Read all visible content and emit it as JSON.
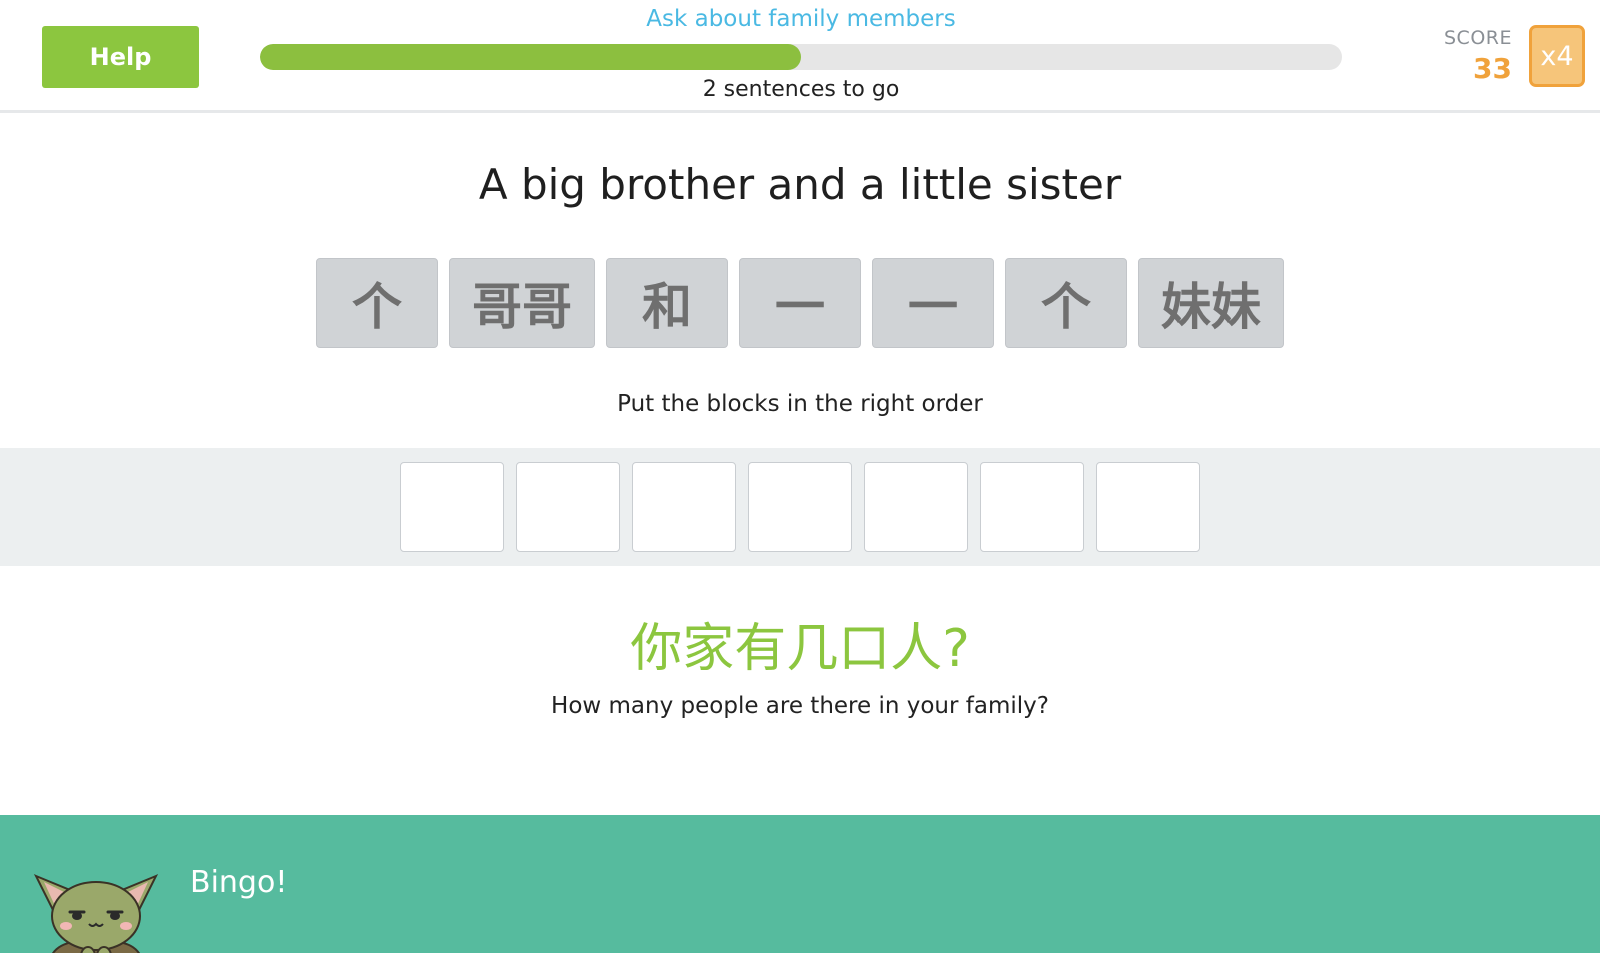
{
  "header": {
    "help_label": "Help",
    "lesson_title": "Ask about family members",
    "progress_fraction": 0.5,
    "progress_caption": "2 sentences to go",
    "score_label": "SCORE",
    "score_value": "33",
    "multiplier": "x4"
  },
  "prompt": {
    "sentence": "A big brother and a little sister",
    "blocks": [
      "个",
      "哥哥",
      "和",
      "一",
      "一",
      "个",
      "妹妹"
    ],
    "instruction": "Put the blocks in the right order",
    "answer_slot_count": 7
  },
  "topic": {
    "chinese": "你家有几口人?",
    "english": "How many people are there in your family?"
  },
  "feedback": {
    "message": "Bingo!",
    "mascot_icon": "cat-mascot-icon"
  },
  "colors": {
    "accent_green": "#8cc63f",
    "title_blue": "#4ab9e3",
    "score_orange": "#f0a23b",
    "feedback_teal": "#56bb9e"
  }
}
